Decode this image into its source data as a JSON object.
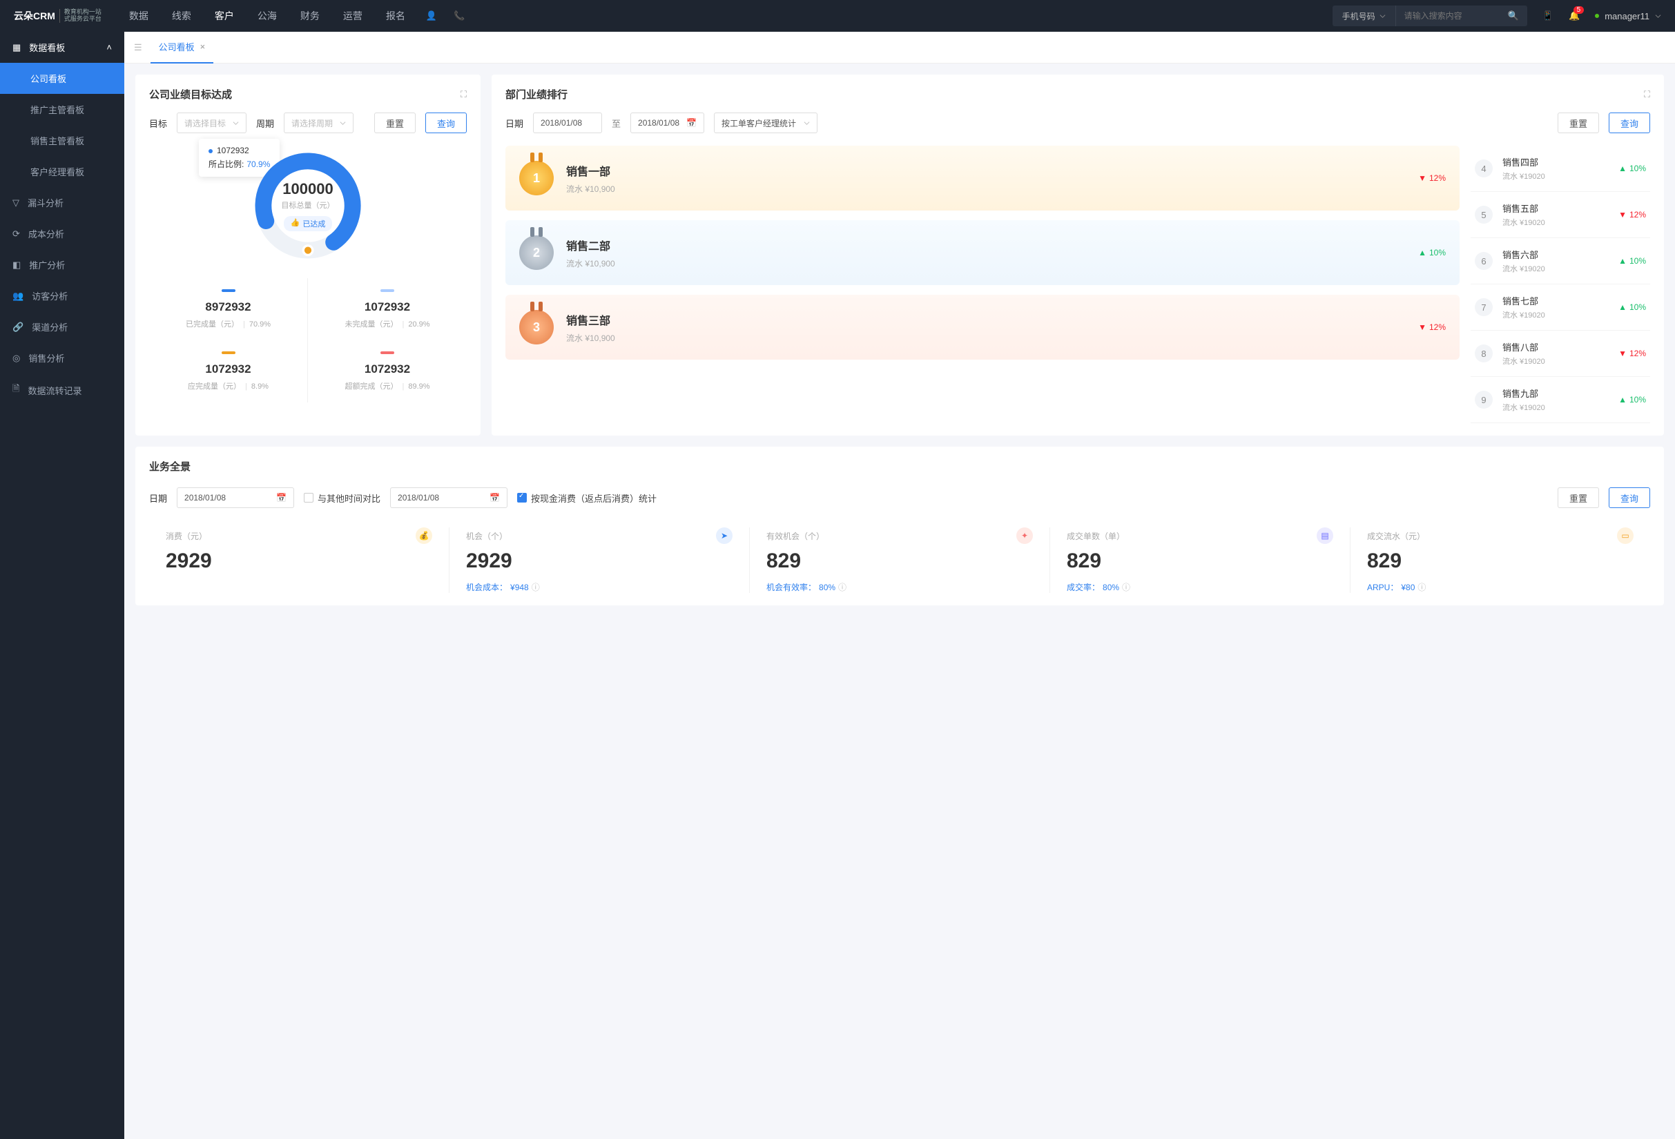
{
  "header": {
    "logo_main": "云朵CRM",
    "logo_sub1": "教育机构一站",
    "logo_sub2": "式服务云平台",
    "nav": [
      "数据",
      "线索",
      "客户",
      "公海",
      "财务",
      "运营",
      "报名"
    ],
    "nav_active": 2,
    "search_type": "手机号码",
    "search_placeholder": "请输入搜索内容",
    "notif_count": "5",
    "user": "manager11"
  },
  "sidebar": {
    "group_title": "数据看板",
    "subs": [
      "公司看板",
      "推广主管看板",
      "销售主管看板",
      "客户经理看板"
    ],
    "active_sub": 0,
    "items": [
      "漏斗分析",
      "成本分析",
      "推广分析",
      "访客分析",
      "渠道分析",
      "销售分析",
      "数据流转记录"
    ]
  },
  "tab": {
    "label": "公司看板"
  },
  "goal": {
    "title": "公司业绩目标达成",
    "target_label": "目标",
    "target_ph": "请选择目标",
    "period_label": "周期",
    "period_ph": "请选择周期",
    "reset": "重置",
    "query": "查询",
    "tooltip_val": "1072932",
    "tooltip_label": "所占比例:",
    "tooltip_pct": "70.9%",
    "center_val": "100000",
    "center_label": "目标总量（元）",
    "center_tag": "已达成",
    "metrics": [
      {
        "bar": "#2f80ed",
        "val": "8972932",
        "label": "已完成量（元）",
        "pct": "70.9%"
      },
      {
        "bar": "#a9cbff",
        "val": "1072932",
        "label": "未完成量（元）",
        "pct": "20.9%"
      },
      {
        "bar": "#f0a020",
        "val": "1072932",
        "label": "应完成量（元）",
        "pct": "8.9%"
      },
      {
        "bar": "#f56c6c",
        "val": "1072932",
        "label": "超额完成（元）",
        "pct": "89.9%"
      }
    ]
  },
  "rank": {
    "title": "部门业绩排行",
    "date_label": "日期",
    "date_from": "2018/01/08",
    "date_to_lbl": "至",
    "date_to": "2018/01/08",
    "stat_type": "按工单客户经理统计",
    "reset": "重置",
    "query": "查询",
    "podium": [
      {
        "n": "1",
        "name": "销售一部",
        "val": "流水 ¥10,900",
        "pct": "12%",
        "dir": "down"
      },
      {
        "n": "2",
        "name": "销售二部",
        "val": "流水 ¥10,900",
        "pct": "10%",
        "dir": "up"
      },
      {
        "n": "3",
        "name": "销售三部",
        "val": "流水 ¥10,900",
        "pct": "12%",
        "dir": "down"
      }
    ],
    "list": [
      {
        "n": "4",
        "name": "销售四部",
        "val": "流水 ¥19020",
        "pct": "10%",
        "dir": "up"
      },
      {
        "n": "5",
        "name": "销售五部",
        "val": "流水 ¥19020",
        "pct": "12%",
        "dir": "down"
      },
      {
        "n": "6",
        "name": "销售六部",
        "val": "流水 ¥19020",
        "pct": "10%",
        "dir": "up"
      },
      {
        "n": "7",
        "name": "销售七部",
        "val": "流水 ¥19020",
        "pct": "10%",
        "dir": "up"
      },
      {
        "n": "8",
        "name": "销售八部",
        "val": "流水 ¥19020",
        "pct": "12%",
        "dir": "down"
      },
      {
        "n": "9",
        "name": "销售九部",
        "val": "流水 ¥19020",
        "pct": "10%",
        "dir": "up"
      }
    ]
  },
  "overview": {
    "title": "业务全景",
    "date_label": "日期",
    "date1": "2018/01/08",
    "compare_label": "与其他时间对比",
    "date2": "2018/01/08",
    "cash_label": "按现金消费（返点后消费）统计",
    "reset": "重置",
    "query": "查询",
    "stats": [
      {
        "label": "消费（元）",
        "val": "2929",
        "sub_l": "",
        "sub_v": "",
        "icon": "💰",
        "cls": "si1"
      },
      {
        "label": "机会（个）",
        "val": "2929",
        "sub_l": "机会成本：",
        "sub_v": "¥948",
        "icon": "➤",
        "cls": "si2"
      },
      {
        "label": "有效机会（个）",
        "val": "829",
        "sub_l": "机会有效率：",
        "sub_v": "80%",
        "icon": "✦",
        "cls": "si3"
      },
      {
        "label": "成交单数（单）",
        "val": "829",
        "sub_l": "成交率：",
        "sub_v": "80%",
        "icon": "▤",
        "cls": "si4"
      },
      {
        "label": "成交流水（元）",
        "val": "829",
        "sub_l": "ARPU：",
        "sub_v": "¥80",
        "icon": "▭",
        "cls": "si5"
      }
    ]
  },
  "chart_data": {
    "type": "pie",
    "title": "目标总量（元）",
    "total": 100000,
    "series": [
      {
        "name": "已完成量（元）",
        "value": 8972932,
        "pct": 70.9,
        "color": "#2f80ed"
      },
      {
        "name": "未完成量（元）",
        "value": 1072932,
        "pct": 20.9,
        "color": "#a9cbff"
      },
      {
        "name": "应完成量（元）",
        "value": 1072932,
        "pct": 8.9,
        "color": "#f0a020"
      },
      {
        "name": "超额完成（元）",
        "value": 1072932,
        "pct": 89.9,
        "color": "#f56c6c"
      }
    ]
  }
}
